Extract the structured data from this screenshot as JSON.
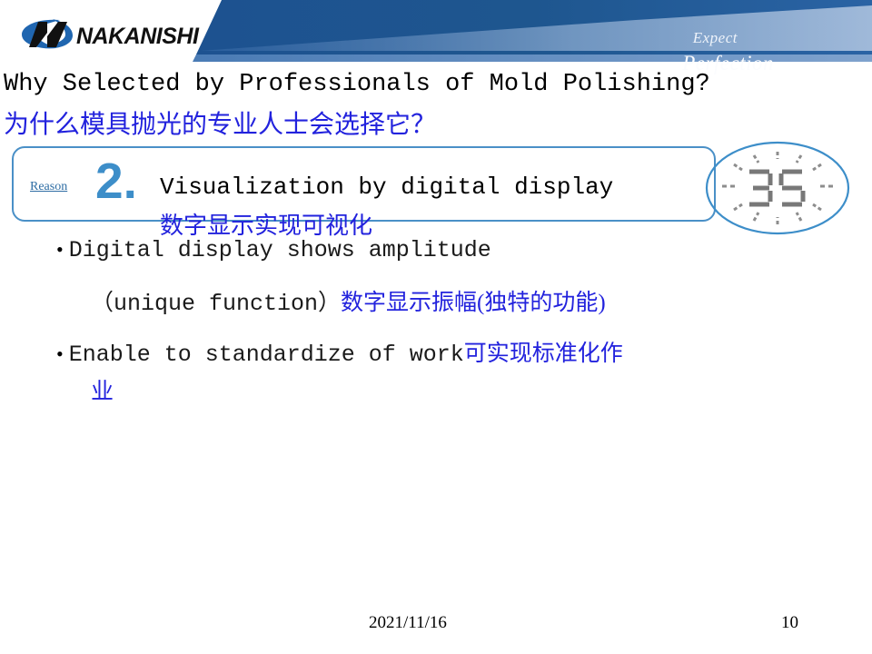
{
  "slide": {
    "header": {
      "logo_alt": "NAKANISHI",
      "tagline_line1": "Expect",
      "tagline_line2": "Perfection",
      "banner_color": "#1c5496",
      "banner_light_color": "#5b87c4"
    },
    "title": {
      "english": "Why Selected by Professionals of Mold Polishing?",
      "chinese": "为什么模具抛光的专业人士会选择它？"
    },
    "reason_box": {
      "label": "Reason",
      "number": "2.",
      "text_english": "Visualization by digital display",
      "text_chinese": "数字显示实现可视化",
      "border_color": "#4a90c7",
      "number_color": "#3d8ec9",
      "label_color": "#2e6da4"
    },
    "digital_display": {
      "reading": "35",
      "icon": "seven-segment-display-with-rays",
      "circle_color": "#3d8ec9",
      "segment_color": "#6f6f6f"
    },
    "bullets": [
      {
        "marker": "•",
        "line1_english": "Digital display shows amplitude",
        "line2_english": "（unique function）",
        "line2_chinese": "数字显示振幅(独特的功能)"
      },
      {
        "marker": "•",
        "line1_english": "Enable to standardize of work",
        "line1_chinese": "可实现标准化作",
        "line2_chinese": "业"
      }
    ],
    "footer": {
      "date": "2021/11/16",
      "page_number": "10"
    },
    "colors": {
      "accent_blue": "#2222dd",
      "brand_blue": "#1c5496",
      "light_blue": "#3d8ec9"
    }
  }
}
